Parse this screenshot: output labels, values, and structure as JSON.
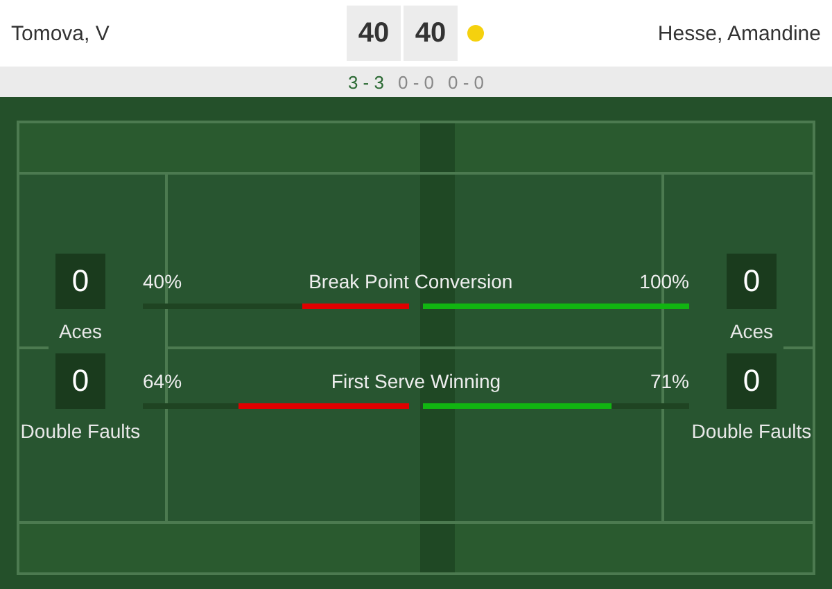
{
  "players": [
    {
      "name": "Tomova, V",
      "points": "40",
      "serving": false
    },
    {
      "name": "Hesse, Amandine",
      "points": "40",
      "serving": true
    }
  ],
  "sets": [
    {
      "score": "3 - 3",
      "selected": true
    },
    {
      "score": "0 - 0",
      "selected": false
    },
    {
      "score": "0 - 0",
      "selected": false
    }
  ],
  "stats": [
    {
      "left_box": "0",
      "left_label": "Aces",
      "left_value": "40%",
      "left_bar": {
        "level": 0.4
      },
      "title": "Break Point Conversion",
      "right_value": "100%",
      "right_bar": {
        "level": 1.0
      },
      "right_box": "0",
      "right_label": "Aces"
    },
    {
      "left_box": "0",
      "left_label": "Double Faults",
      "left_value": "64%",
      "left_bar": {
        "level": 0.64
      },
      "title": "First Serve Winning",
      "right_value": "71%",
      "right_bar": {
        "level": 0.71
      },
      "right_box": "0",
      "right_label": "Double Faults"
    }
  ]
}
